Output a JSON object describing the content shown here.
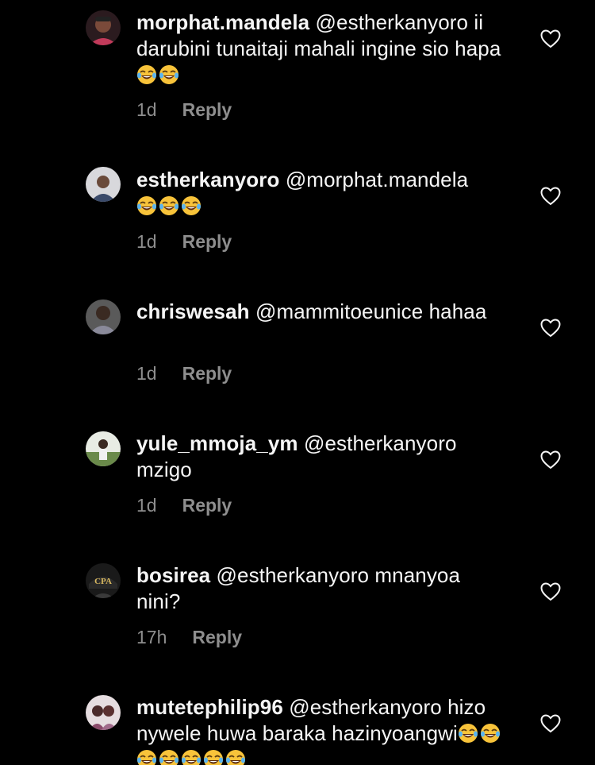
{
  "comments": [
    {
      "username": "morphat.mandela",
      "text": "@estherkanyoro ii darubini tunaitaji mahali ingine sio hapa",
      "emoji_count": 2,
      "time": "1d",
      "reply_label": "Reply",
      "avatar_color": "#3a2a2a"
    },
    {
      "username": "estherkanyoro",
      "text": "@morphat.mandela",
      "emoji_count": 3,
      "time": "1d",
      "reply_label": "Reply",
      "avatar_color": "#6a6a7a"
    },
    {
      "username": "chriswesah",
      "text": "@mammitoeunice hahaa",
      "emoji_count": 0,
      "time": "1d",
      "reply_label": "Reply",
      "avatar_color": "#4a4a4a"
    },
    {
      "username": "yule_mmoja_ym",
      "text": "@estherkanyoro mzigo",
      "emoji_count": 0,
      "time": "1d",
      "reply_label": "Reply",
      "avatar_color": "#6b8a5a"
    },
    {
      "username": "bosirea",
      "text": "@estherkanyoro mnanyoa nini?",
      "emoji_count": 0,
      "time": "17h",
      "reply_label": "Reply",
      "avatar_color": "#1a1a1a",
      "avatar_text": "CPA"
    },
    {
      "username": "mutetephilip96",
      "text": "@estherkanyoro hizo nywele huwa baraka hazinyoangwi",
      "emoji_count": 7,
      "time": "",
      "reply_label": "",
      "avatar_color": "#cfc4c8"
    }
  ],
  "colors": {
    "background": "#000000",
    "text": "#f5f5f5",
    "muted": "#8e8e8e"
  },
  "icons": {
    "like": "heart-outline-icon",
    "emoji": "face-with-tears-of-joy-emoji"
  }
}
